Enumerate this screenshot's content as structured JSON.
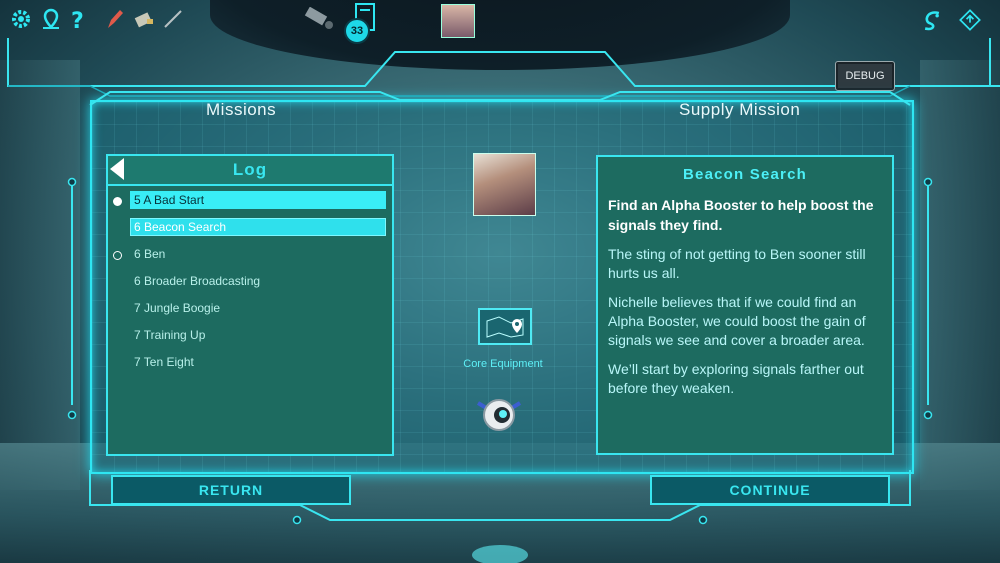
{
  "hud": {
    "icons": [
      "gear-icon",
      "map-pin-icon",
      "help-icon",
      "pen-icon",
      "tool-icon",
      "wand-icon",
      "scanner-icon",
      "journal-icon",
      "avatar",
      "dragon-logo-icon",
      "compass-icon"
    ],
    "journal_count": "33"
  },
  "debug_label": "DEBUG",
  "headers": {
    "missions": "Missions",
    "supply": "Supply Mission"
  },
  "log": {
    "title": "Log",
    "items": [
      {
        "label": "5 A Bad Start",
        "dot": "filled",
        "state": "active"
      },
      {
        "label": "6 Beacon Search",
        "dot": "none",
        "state": "selected"
      },
      {
        "label": "6 Ben",
        "dot": "open",
        "state": ""
      },
      {
        "label": "6 Broader Broadcasting",
        "dot": "none",
        "state": ""
      },
      {
        "label": "7 Jungle Boogie",
        "dot": "none",
        "state": ""
      },
      {
        "label": "7 Training Up",
        "dot": "none",
        "state": ""
      },
      {
        "label": "7 Ten Eight",
        "dot": "none",
        "state": ""
      }
    ]
  },
  "center": {
    "map_label": "Core Equipment"
  },
  "detail": {
    "title": "Beacon Search",
    "lead": "Find an Alpha Booster to help boost the signals they find.",
    "paragraphs": [
      "The sting of not getting to Ben sooner still hurts us all.",
      "Nichelle believes that if we could find an Alpha Booster, we could boost the gain of signals we see and cover a broader area.",
      "We’ll start by exploring signals farther out before they weaken."
    ]
  },
  "buttons": {
    "return": "RETURN",
    "continue": "CONTINUE"
  },
  "colors": {
    "accent": "#39e6f0",
    "panel": "#1d6b60"
  }
}
